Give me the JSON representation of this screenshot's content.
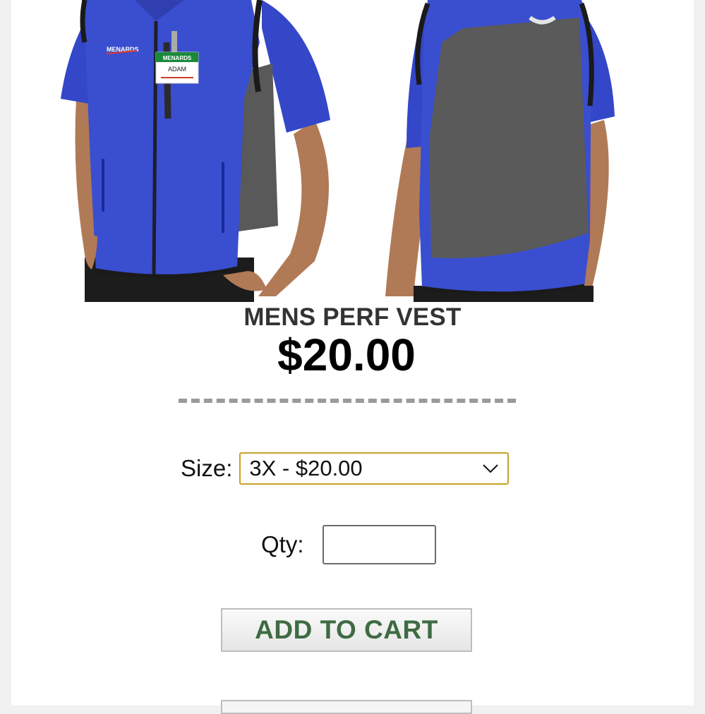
{
  "product": {
    "name": "MENS PERF VEST",
    "price": "$20.00",
    "badge_brand": "MENARDS",
    "badge_name": "ADAM",
    "vest_logo": "MENARDS"
  },
  "size": {
    "label": "Size:",
    "selected": "3X - $20.00"
  },
  "qty": {
    "label": "Qty:",
    "value": ""
  },
  "actions": {
    "add_to_cart": "ADD TO CART"
  },
  "icons": {
    "select_arrow": "chevron-down-icon"
  },
  "colors": {
    "vest_blue": "#3a4ed0",
    "vest_gray": "#5a5a5a",
    "select_border": "#c9a227",
    "button_text": "#3f6b43"
  }
}
